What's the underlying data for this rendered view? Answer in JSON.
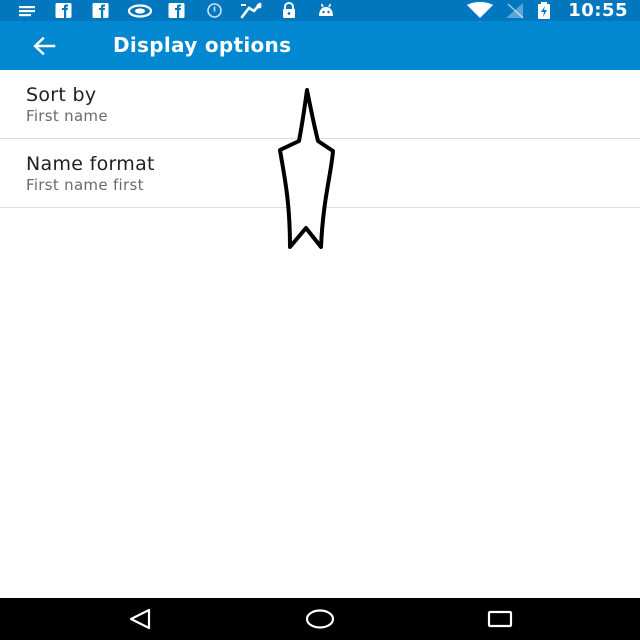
{
  "status_bar": {
    "time": "10:55",
    "notification_icons": [
      "message-icon",
      "facebook-icon",
      "facebook-icon",
      "nvidia-icon",
      "facebook-icon",
      "alarm-icon",
      "fitness-icon",
      "lock-icon",
      "android-icon"
    ],
    "system_icons": [
      "wifi-icon",
      "no-signal-icon",
      "battery-charging-icon"
    ],
    "background": "#0277bd"
  },
  "toolbar": {
    "title": "Display options",
    "back_icon": "arrow-back-icon",
    "background": "#0288d1"
  },
  "settings": [
    {
      "title": "Sort by",
      "summary": "First name"
    },
    {
      "title": "Name format",
      "summary": "First name first"
    }
  ],
  "nav_bar": {
    "buttons": [
      "back-triangle-icon",
      "home-circle-icon",
      "recents-square-icon"
    ],
    "background": "#000000"
  },
  "annotation": {
    "shape": "arrow-up-icon",
    "color": "#000000"
  }
}
